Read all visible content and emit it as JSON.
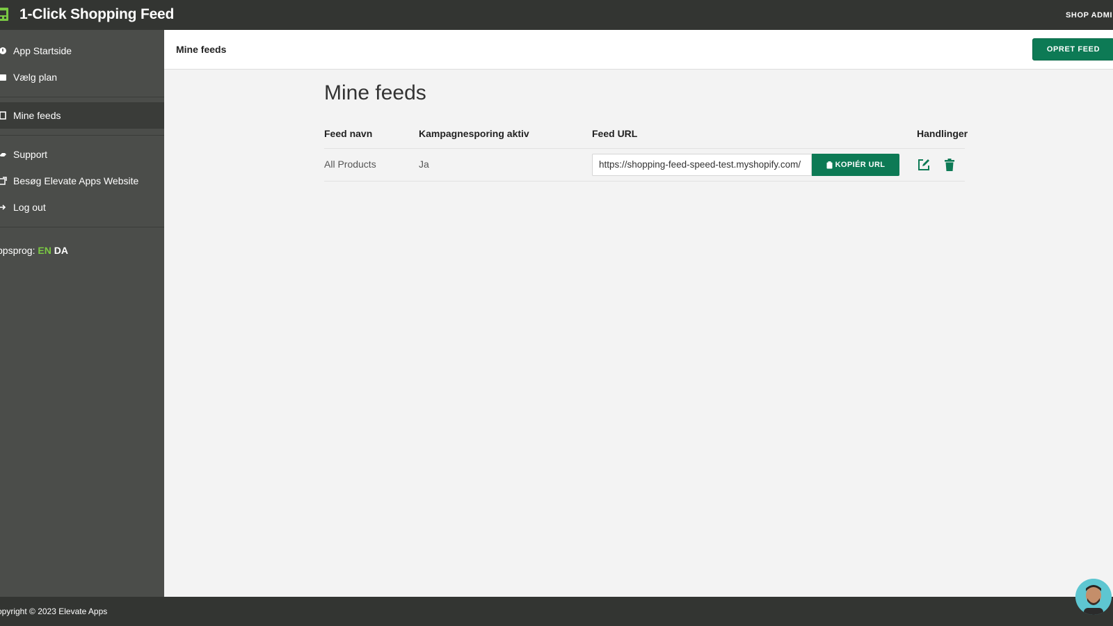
{
  "header": {
    "app_title": "1-Click Shopping Feed",
    "shop_admin": "SHOP ADMI"
  },
  "sidebar": {
    "items": [
      {
        "label": "App Startside",
        "icon": "home-icon"
      },
      {
        "label": "Vælg plan",
        "icon": "plan-icon"
      },
      {
        "label": "Mine feeds",
        "icon": "feeds-icon",
        "active": true
      },
      {
        "label": "Support",
        "icon": "support-icon"
      },
      {
        "label": "Besøg Elevate Apps Website",
        "icon": "external-link-icon"
      },
      {
        "label": "Log out",
        "icon": "logout-icon"
      }
    ],
    "lang_label": "ppsprog: ",
    "lang_en": "EN",
    "lang_da": "DA"
  },
  "subheader": {
    "title": "Mine feeds",
    "create_button": "OPRET FEED"
  },
  "main": {
    "page_title": "Mine feeds",
    "columns": [
      "Feed navn",
      "Kampagnesporing aktiv",
      "Feed URL",
      "Handlinger"
    ],
    "rows": [
      {
        "feed_name": "All Products",
        "campaign_tracking": "Ja",
        "feed_url": "https://shopping-feed-speed-test.myshopify.com/",
        "copy_button": "KOPIÉR URL"
      }
    ]
  },
  "footer": {
    "copyright": "opyright © 2023 Elevate Apps"
  },
  "colors": {
    "topbar": "#333532",
    "sidebar": "#4b4d4a",
    "accent": "#0d7a55",
    "lang_active": "#7ac943"
  }
}
